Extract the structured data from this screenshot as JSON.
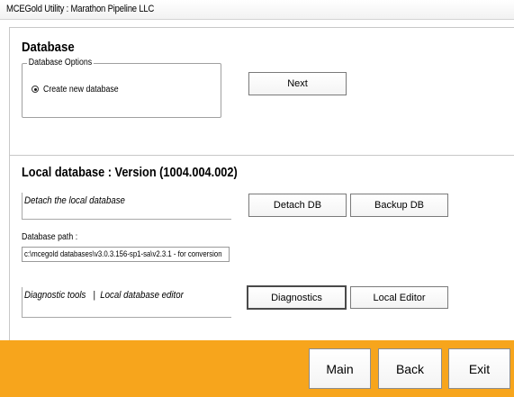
{
  "window": {
    "title": "MCEGold Utility : Marathon Pipeline LLC"
  },
  "database_section": {
    "heading": "Database",
    "group_label": "Database Options",
    "radio_option": {
      "label": "Create new database",
      "selected": true
    },
    "next_button": "Next"
  },
  "local_section": {
    "heading": "Local database : Version (1004.004.002)",
    "detach_caption": "Detach the local database",
    "detach_button": "Detach DB",
    "backup_button": "Backup DB",
    "path_label": "Database path :",
    "path_value": "c:\\mcegold databases\\v3.0.3.156-sp1-sa\\v2.3.1 - for conversion",
    "tools_caption": "Diagnostic tools   |  Local database editor",
    "diagnostics_button": "Diagnostics",
    "local_editor_button": "Local Editor"
  },
  "footer": {
    "main_button": "Main",
    "back_button": "Back",
    "exit_button": "Exit",
    "color": "#f7a51c"
  }
}
